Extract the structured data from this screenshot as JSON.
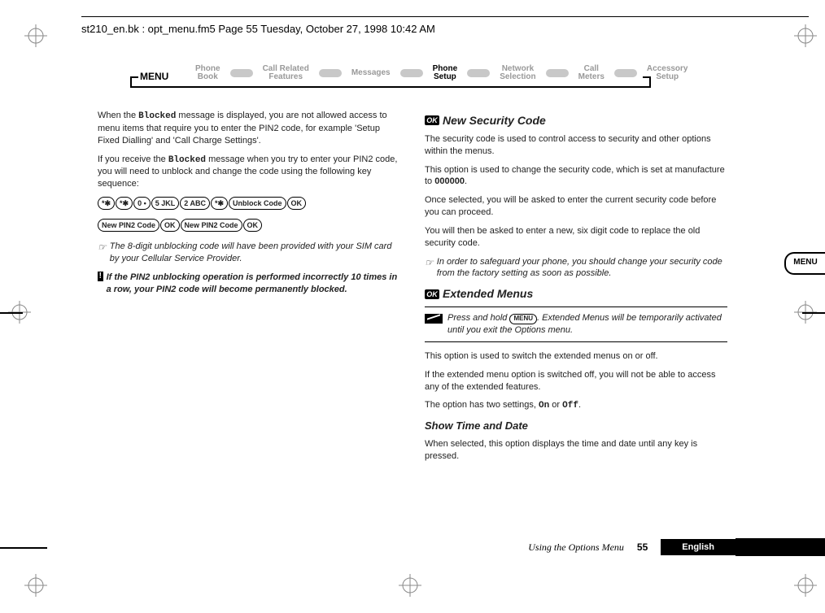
{
  "header": "st210_en.bk : opt_menu.fm5  Page 55  Tuesday, October 27, 1998  10:42 AM",
  "menu": {
    "label": "MENU",
    "items": [
      {
        "l1": "Phone",
        "l2": "Book",
        "active": false
      },
      {
        "l1": "Call Related",
        "l2": "Features",
        "active": false
      },
      {
        "l1": "Messages",
        "l2": "",
        "active": false
      },
      {
        "l1": "Phone",
        "l2": "Setup",
        "active": true
      },
      {
        "l1": "Network",
        "l2": "Selection",
        "active": false
      },
      {
        "l1": "Call",
        "l2": "Meters",
        "active": false
      },
      {
        "l1": "Accessory",
        "l2": "Setup",
        "active": false
      }
    ]
  },
  "side_tab": "MENU",
  "left": {
    "p1a": "When the ",
    "p1b": "Blocked",
    "p1c": " message is displayed, you are not allowed access to menu items that require you to enter the PIN2 code, for example 'Setup Fixed Dialling' and 'Call Charge Settings'.",
    "p2a": "If you receive the ",
    "p2b": "Blocked",
    "p2c": " message when you try to enter your PIN2 code, you will need to unblock and change the code using the following key sequence:",
    "keys1": [
      "*✱",
      "*✱",
      "0 •",
      "5 JKL",
      "2 ABC",
      "*✱",
      "Unblock Code",
      "OK"
    ],
    "keys2": [
      "New PIN2 Code",
      "OK",
      "New PIN2 Code",
      "OK"
    ],
    "note": "The 8-digit unblocking code will have been provided with your SIM card by your Cellular Service Provider.",
    "warn": "If the PIN2 unblocking operation is performed incorrectly 10 times in a row, your PIN2 code will become permanently blocked."
  },
  "right": {
    "h_sec": "New Security Code",
    "sec_p1": "The security code is used to control access to security and other options within the menus.",
    "sec_p2a": "This option is used to change the security code, which is set at manufacture to ",
    "sec_p2b": "000000",
    "sec_p2c": ".",
    "sec_p3": "Once selected, you will be asked to enter the current security code before you can proceed.",
    "sec_p4": "You will then be asked to enter a new, six digit code to replace the old security code.",
    "sec_note": "In order to safeguard your phone, you should change your security code from the factory setting as soon as possible.",
    "h_ext": "Extended Menus",
    "tip_a": "Press and hold ",
    "tip_key": "MENU",
    "tip_b": ". Extended Menus will be temporarily activated until you exit the Options menu.",
    "ext_p1": "This option is used to switch the extended menus on or off.",
    "ext_p2": "If the extended menu option is switched off, you will not be able to access any of the extended features.",
    "ext_p3a": "The option has two settings, ",
    "ext_p3b": "On",
    "ext_p3c": " or ",
    "ext_p3d": "Off",
    "ext_p3e": ".",
    "h_time": "Show Time and Date",
    "time_p": "When selected, this option displays the time and date until any key is pressed."
  },
  "footer": {
    "section": "Using the Options Menu",
    "page": "55",
    "lang": "English"
  },
  "ok_label": "OK",
  "pointer_glyph": "☞"
}
